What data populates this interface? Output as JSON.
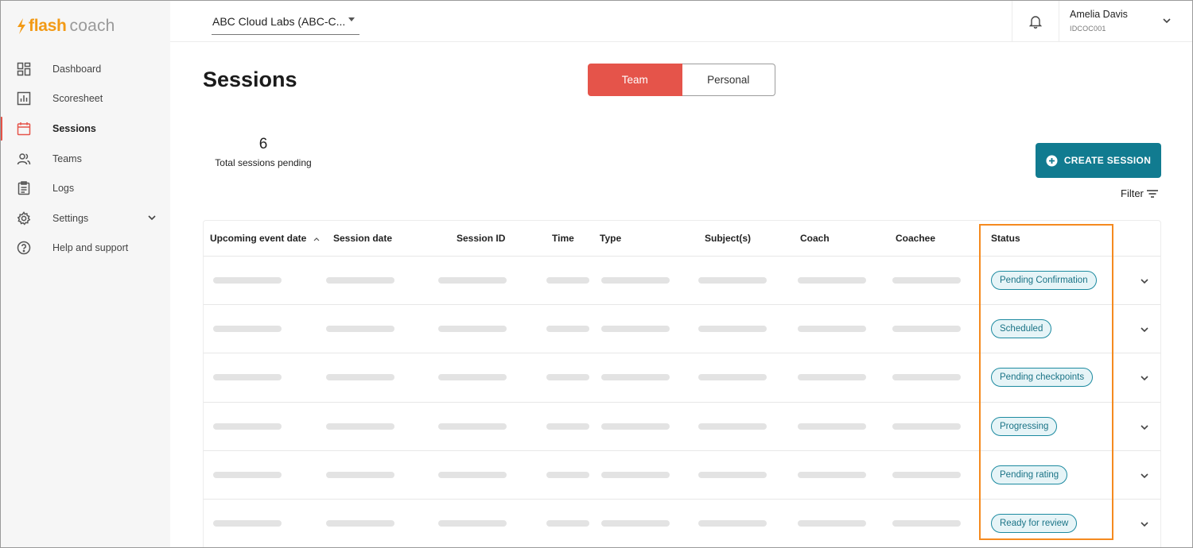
{
  "brand": {
    "flash": "flash",
    "coach": "coach",
    "accent": "#f29a16"
  },
  "sidebar": {
    "items": [
      {
        "label": "Dashboard",
        "icon": "dashboard-icon"
      },
      {
        "label": "Scoresheet",
        "icon": "chart-icon"
      },
      {
        "label": "Sessions",
        "icon": "calendar-icon",
        "active": true
      },
      {
        "label": "Teams",
        "icon": "people-icon"
      },
      {
        "label": "Logs",
        "icon": "clipboard-icon"
      },
      {
        "label": "Settings",
        "icon": "gear-icon"
      },
      {
        "label": "Help and support",
        "icon": "help-icon"
      }
    ]
  },
  "header": {
    "org": "ABC Cloud Labs (ABC-C...",
    "user_name": "Amelia Davis",
    "user_id": "IDCOC001"
  },
  "page": {
    "title": "Sessions",
    "toggle": {
      "team": "Team",
      "personal": "Personal",
      "active": "Team"
    },
    "pending_count": "6",
    "pending_label": "Total sessions pending",
    "create_label": "CREATE SESSION",
    "filter_label": "Filter"
  },
  "table": {
    "columns": [
      "Upcoming event date",
      "Session date",
      "Session ID",
      "Time",
      "Type",
      "Subject(s)",
      "Coach",
      "Coachee",
      "Status"
    ],
    "rows": [
      {
        "status": "Pending Confirmation"
      },
      {
        "status": "Scheduled"
      },
      {
        "status": "Pending checkpoints"
      },
      {
        "status": "Progressing"
      },
      {
        "status": "Pending rating"
      },
      {
        "status": "Ready for review"
      }
    ]
  },
  "colors": {
    "primary": "#117b90",
    "team_active": "#e5544a",
    "badge_border": "#1c8aa0",
    "highlight": "#f58a1f"
  }
}
